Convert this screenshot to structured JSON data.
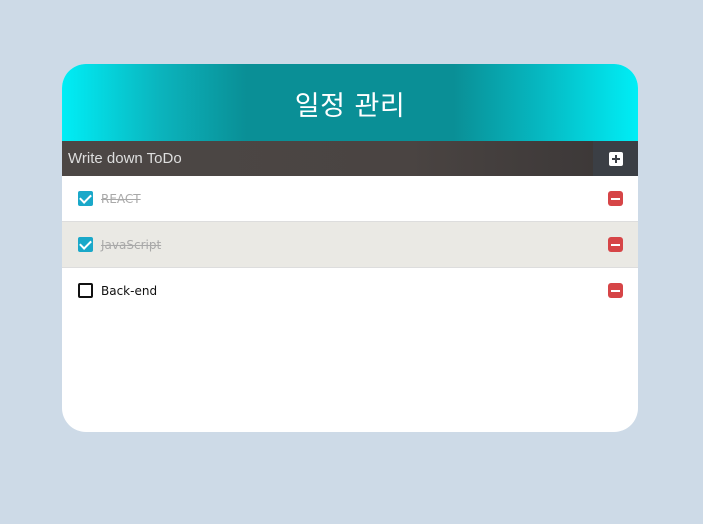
{
  "header": {
    "title": "일정 관리"
  },
  "input": {
    "placeholder": "Write down ToDo",
    "value": ""
  },
  "todos": [
    {
      "text": "REACT",
      "checked": true
    },
    {
      "text": "JavaScript",
      "checked": true
    },
    {
      "text": "Back-end",
      "checked": false
    }
  ],
  "colors": {
    "page_background": "#cddae7",
    "header_gradient_edge": "#00eef6",
    "header_gradient_center": "#0a8f96",
    "checkbox_checked": "#1aa8c9",
    "remove_button": "#d64547",
    "add_button": "#3b3f45"
  },
  "icons": {
    "add": "plus-square-icon",
    "checked": "checkbox-checked-icon",
    "unchecked": "checkbox-empty-icon",
    "remove": "minus-square-icon"
  }
}
